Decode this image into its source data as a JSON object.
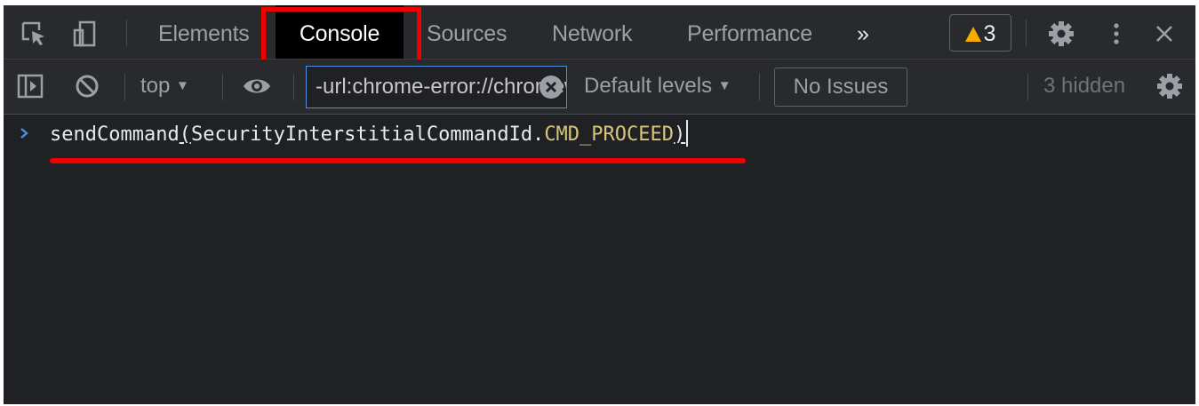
{
  "tabs": {
    "elements": "Elements",
    "console": "Console",
    "sources": "Sources",
    "network": "Network",
    "performance": "Performance",
    "more": "»"
  },
  "warnings": {
    "count": "3"
  },
  "toolbar": {
    "context": "top",
    "context_arrow": "▼",
    "filter_value": "-url:chrome-error://chromewebdata/",
    "levels": "Default levels",
    "levels_arrow": "▼",
    "issues": "No Issues",
    "hidden": "3 hidden"
  },
  "console": {
    "func": "sendCommand",
    "open_paren": "(",
    "object": "SecurityInterstitialCommandId.",
    "arg": "CMD_PROCEED",
    "close_paren": ")"
  },
  "colors": {
    "highlight": "#f20000",
    "warning": "#f9ab00",
    "focus_border": "#4d90e0"
  }
}
